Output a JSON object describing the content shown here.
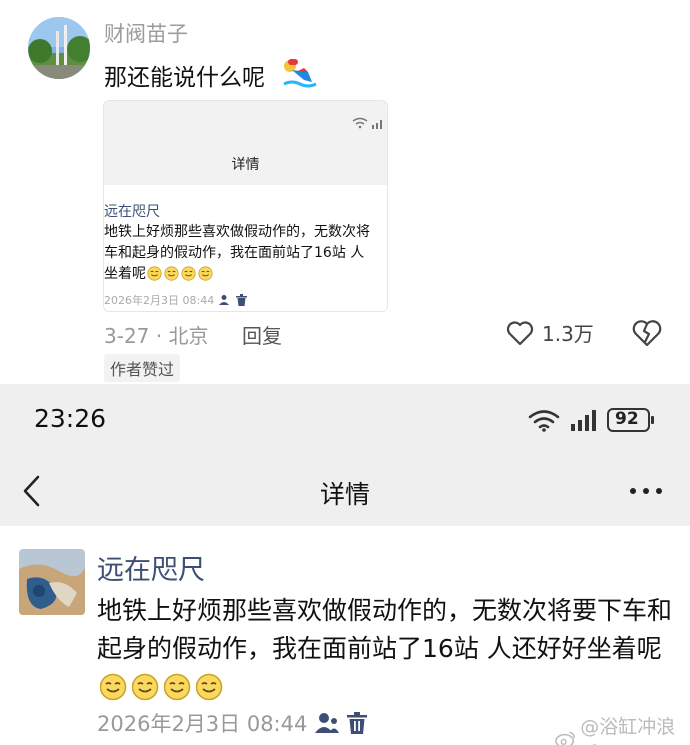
{
  "comment": {
    "username": "财阀苗子",
    "text": "那还能说什么呢",
    "emoji_icon": "swimming-person-emoji",
    "date_location": "3-27 · 北京",
    "reply_label": "回复",
    "like_count": "1.3万",
    "author_badge": "作者赞过"
  },
  "thumbnail": {
    "title": "详情",
    "username": "远在咫尺",
    "body": "地铁上好烦那些喜欢做假动作的，无数次将\n车和起身的假动作，我在面前站了16站 人\n坐着呢",
    "timestamp": "2026年2月3日 08:44"
  },
  "screenshot": {
    "status_bar": {
      "time": "23:26",
      "battery": "92"
    },
    "nav": {
      "title": "详情"
    },
    "post": {
      "username": "远在咫尺",
      "body": "地铁上好烦那些喜欢做假动作的，无数次将要下车和起身的假动作，我在面前站了16站 人还好好坐着呢",
      "timestamp": "2026年2月3日 08:44"
    }
  },
  "watermark": "@浴缸冲浪手",
  "colors": {
    "username_blue": "#3d4f74",
    "header_gray": "#efefef",
    "muted_text": "#999999"
  }
}
